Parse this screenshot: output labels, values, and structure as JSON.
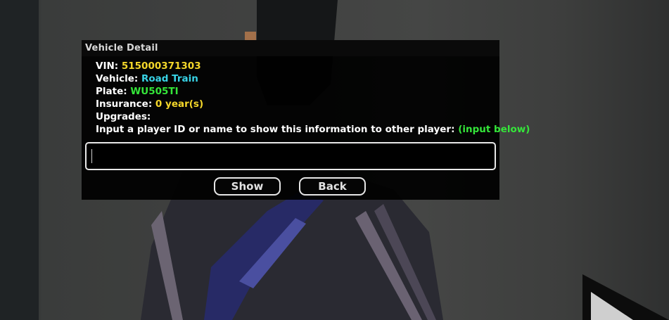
{
  "dialog": {
    "title": "Vehicle Detail",
    "vin_label": "VIN:",
    "vin_value": "515000371303",
    "vehicle_label": "Vehicle:",
    "vehicle_value": "Road Train",
    "plate_label": "Plate:",
    "plate_value": "WU505TI",
    "insurance_label": "Insurance:",
    "insurance_value": "0 year(s)",
    "upgrades_label": "Upgrades:",
    "prompt_text": "Input a player ID or name to show this information to other player:",
    "prompt_hint": "(input below)",
    "input_value": "",
    "buttons": {
      "show": "Show",
      "back": "Back"
    }
  },
  "colors": {
    "vin": "#f4d72a",
    "vehicle": "#38d3e6",
    "plate": "#35e63a",
    "insurance": "#f4d72a",
    "hint": "#35e63a"
  }
}
